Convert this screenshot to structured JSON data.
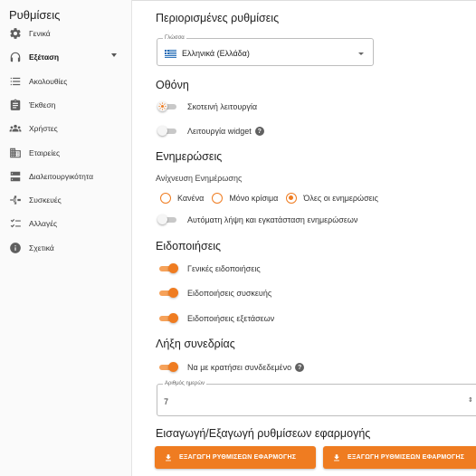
{
  "sidebar": {
    "title": "Ρυθμίσεις",
    "items": [
      {
        "label": "Γενικά",
        "icon": "gear-icon"
      },
      {
        "label": "Εξέταση",
        "icon": "headphones-icon"
      },
      {
        "label": "Ακολουθίες",
        "icon": "list-icon"
      },
      {
        "label": "Έκθεση",
        "icon": "clipboard-icon"
      },
      {
        "label": "Χρήστες",
        "icon": "users-icon"
      },
      {
        "label": "Εταιρείες",
        "icon": "building-icon"
      },
      {
        "label": "Διαλειτουργικότητα",
        "icon": "server-icon"
      },
      {
        "label": "Συσκευές",
        "icon": "devices-icon"
      },
      {
        "label": "Αλλαγές",
        "icon": "checklist-icon"
      },
      {
        "label": "Σχετικά",
        "icon": "info-icon"
      }
    ],
    "active_index": 1
  },
  "main": {
    "restricted": {
      "heading": "Περιορισμένες ρυθμίσεις",
      "language_label": "Γλώσσα",
      "language_value": "Ελληνικά (Ελλάδα)"
    },
    "display": {
      "heading": "Οθόνη",
      "dark_mode_label": "Σκοτεινή λειτουργία",
      "dark_mode_on": false,
      "widget_mode_label": "Λειτουργία widget",
      "widget_mode_on": false
    },
    "updates": {
      "heading": "Ενημερώσεις",
      "detection_label": "Ανίχνευση Ενημέρωσης",
      "options": [
        "Κανένα",
        "Μόνο κρίσιμα",
        "Όλες οι ενημερώσεις"
      ],
      "selected_option": "Όλες οι ενημερώσεις",
      "auto_install_label": "Αυτόματη λήψη και εγκατάσταση ενημερώσεων",
      "auto_install_on": false
    },
    "notifications": {
      "heading": "Ειδοποιήσεις",
      "general_label": "Γενικές ειδοποιήσεις",
      "general_on": true,
      "device_label": "Ειδοποιήσεις συσκευής",
      "device_on": true,
      "exam_label": "Ειδοποιήσεις εξετάσεων",
      "exam_on": true
    },
    "session": {
      "heading": "Λήξη συνεδρίας",
      "keep_logged_label": "Να με κρατήσει συνδεδεμένο",
      "keep_logged_on": true,
      "days_label": "Αριθμός ημερών",
      "days_value": "7"
    },
    "import_export": {
      "heading": "Εισαγωγή/Εξαγωγή ρυθμίσεων εφαρμογής",
      "export_label": "ΕΞΑΓΩΓΗ ΡΥΘΜΙΣΕΩΝ ΕΦΑΡΜΟΓΗΣ",
      "export_label_2": "ΕΞΑΓΩΓΗ ΡΥΘΜΙΣΕΩΝ ΕΦΑΡΜΟΓΗΣ"
    }
  },
  "colors": {
    "accent": "#ef7c21",
    "accent_light": "#f6a25a",
    "sidebar_bg": "#fafafa"
  }
}
